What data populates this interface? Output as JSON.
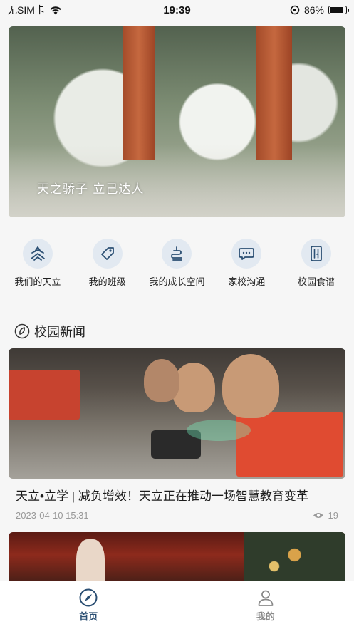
{
  "status_bar": {
    "carrier": "无SIM卡",
    "time": "19:39",
    "battery_percent": "86%",
    "battery_level": 0.86
  },
  "hero": {
    "caption": "天之骄子  立己达人"
  },
  "quick_nav": [
    {
      "label": "我们的天立",
      "icon": "school-logo-icon"
    },
    {
      "label": "我的班级",
      "icon": "tag-icon"
    },
    {
      "label": "我的成长空间",
      "icon": "growth-icon"
    },
    {
      "label": "家校沟通",
      "icon": "chat-icon"
    },
    {
      "label": "校园食谱",
      "icon": "food-menu-icon"
    }
  ],
  "section": {
    "title": "校园新闻"
  },
  "news": [
    {
      "title": "天立•立学 | 减负增效！天立正在推动一场智慧教育变革",
      "date": "2023-04-10 15:31",
      "views": "19"
    }
  ],
  "tab_bar": {
    "home_label": "首页",
    "me_label": "我的"
  },
  "colors": {
    "accent": "#2b4f73",
    "icon_bg": "#e2e9f1",
    "tab_inactive": "#8a8a8a"
  }
}
